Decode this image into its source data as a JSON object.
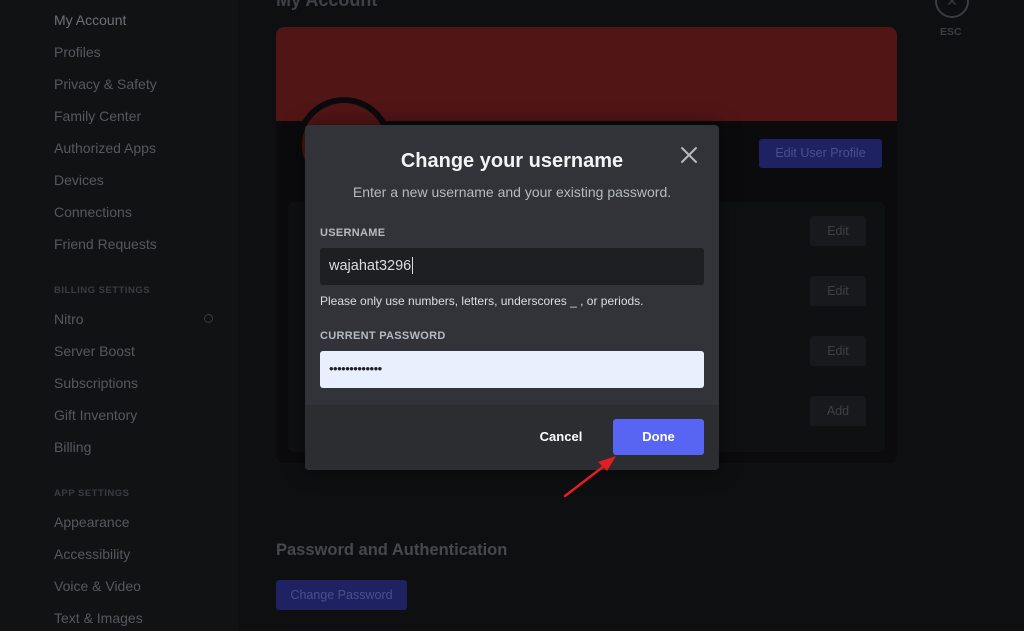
{
  "sidebar": {
    "items_user": [
      {
        "label": "My Account"
      },
      {
        "label": "Profiles"
      },
      {
        "label": "Privacy & Safety"
      },
      {
        "label": "Family Center"
      },
      {
        "label": "Authorized Apps"
      },
      {
        "label": "Devices"
      },
      {
        "label": "Connections"
      },
      {
        "label": "Friend Requests"
      }
    ],
    "billing_header": "BILLING SETTINGS",
    "items_billing": [
      {
        "label": "Nitro"
      },
      {
        "label": "Server Boost"
      },
      {
        "label": "Subscriptions"
      },
      {
        "label": "Gift Inventory"
      },
      {
        "label": "Billing"
      }
    ],
    "app_header": "APP SETTINGS",
    "items_app": [
      {
        "label": "Appearance"
      },
      {
        "label": "Accessibility"
      },
      {
        "label": "Voice & Video"
      },
      {
        "label": "Text & Images"
      }
    ]
  },
  "main": {
    "title": "My Account",
    "esc_label": "ESC",
    "edit_profile_label": "Edit User Profile",
    "edit_label": "Edit",
    "add_label": "Add",
    "section_title": "Password and Authentication",
    "change_password_label": "Change Password"
  },
  "modal": {
    "title": "Change your username",
    "subtitle": "Enter a new username and your existing password.",
    "username_label": "USERNAME",
    "username_value": "wajahat3296",
    "hint": "Please only use numbers, letters, underscores _ , or periods.",
    "password_label": "CURRENT PASSWORD",
    "password_value": "•••••••••••••",
    "cancel_label": "Cancel",
    "done_label": "Done"
  },
  "colors": {
    "accent": "#5865f2",
    "modal_bg": "#313338",
    "banner": "#521516",
    "arrow": "#e01e24"
  },
  "icons": [
    "close-icon",
    "esc-close-icon",
    "nitro-icon",
    "arrow-annotation"
  ]
}
